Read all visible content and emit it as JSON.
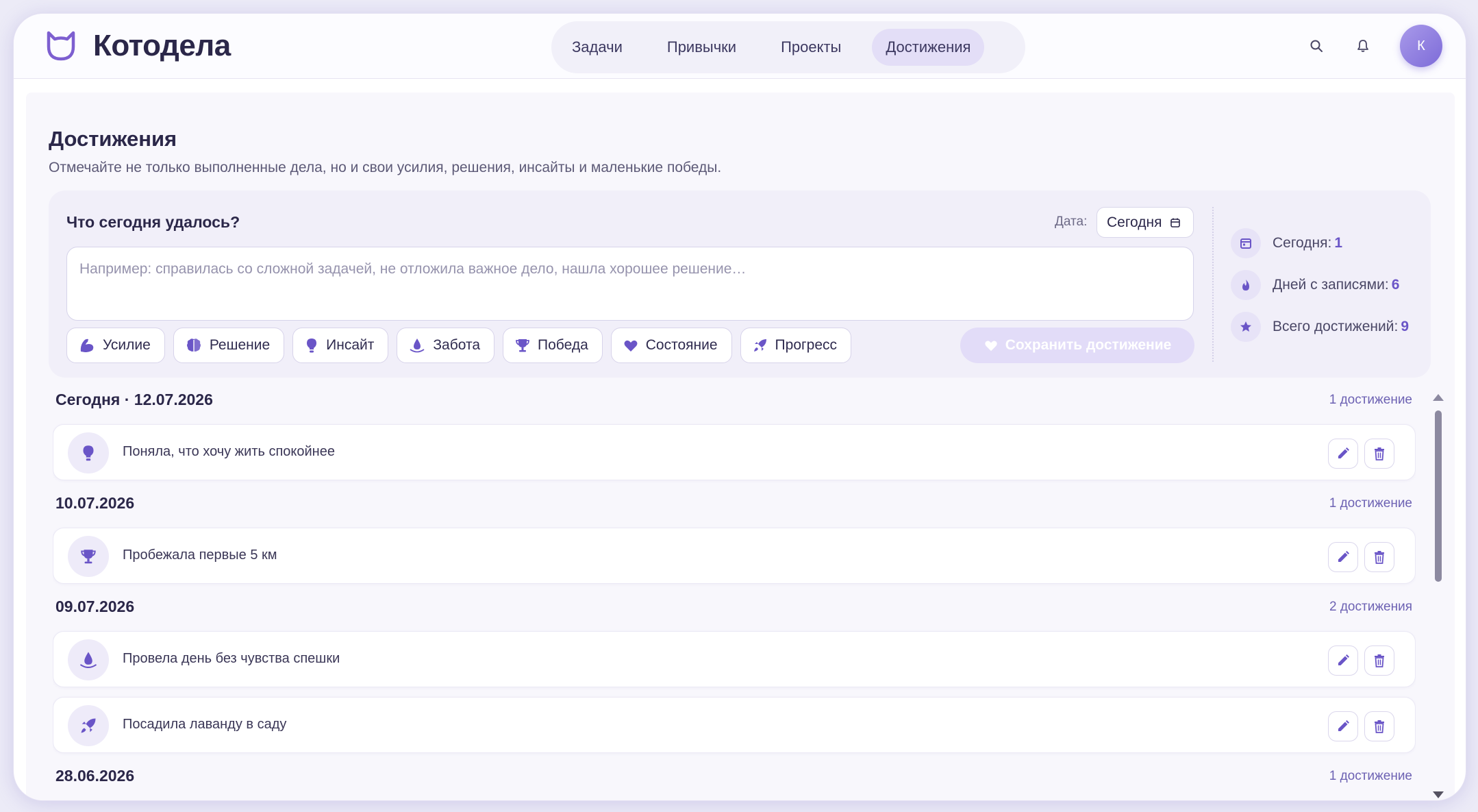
{
  "app": {
    "name": "Котодела",
    "avatar_initial": "К"
  },
  "nav": {
    "items": [
      {
        "label": "Задачи"
      },
      {
        "label": "Привычки"
      },
      {
        "label": "Проекты"
      },
      {
        "label": "Достижения",
        "active": true
      }
    ]
  },
  "page": {
    "title": "Достижения",
    "subtitle": "Отмечайте не только выполненные дела, но и свои усилия, решения, инсайты и маленькие победы."
  },
  "composer": {
    "question": "Что сегодня удалось?",
    "date_label": "Дата:",
    "date_value": "Сегодня",
    "placeholder": "Например: справилась со сложной задачей, не отложила важное дело, нашла хорошее решение…",
    "value": "",
    "categories": [
      {
        "label": "Усилие",
        "icon": "flexed-arm-icon"
      },
      {
        "label": "Решение",
        "icon": "brain-icon"
      },
      {
        "label": "Инсайт",
        "icon": "lightbulb-icon"
      },
      {
        "label": "Забота",
        "icon": "water-drop-icon"
      },
      {
        "label": "Победа",
        "icon": "trophy-icon"
      },
      {
        "label": "Состояние",
        "icon": "heart-icon"
      },
      {
        "label": "Прогресс",
        "icon": "rocket-icon"
      }
    ],
    "save_label": "Сохранить достижение"
  },
  "stats": {
    "today_label": "Сегодня:",
    "today_value": "1",
    "days_label": "Дней с записями:",
    "days_value": "6",
    "total_label": "Всего достижений:",
    "total_value": "9"
  },
  "groups": [
    {
      "date": "Сегодня · 12.07.2026",
      "count": "1 достижение",
      "items": [
        {
          "text": "Поняла, что хочу жить спокойнее",
          "icon": "lightbulb-icon"
        }
      ]
    },
    {
      "date": "10.07.2026",
      "count": "1 достижение",
      "items": [
        {
          "text": "Пробежала первые 5 км",
          "icon": "trophy-icon"
        }
      ]
    },
    {
      "date": "09.07.2026",
      "count": "2 достижения",
      "items": [
        {
          "text": "Провела день без чувства спешки",
          "icon": "water-drop-icon"
        },
        {
          "text": "Посадила лаванду в саду",
          "icon": "rocket-icon"
        }
      ]
    },
    {
      "date": "28.06.2026",
      "count": "1 достижение",
      "items": []
    }
  ],
  "colors": {
    "accent": "#6a55c7",
    "accent_soft": "#e2dcf8",
    "background": "#ecebf7"
  }
}
